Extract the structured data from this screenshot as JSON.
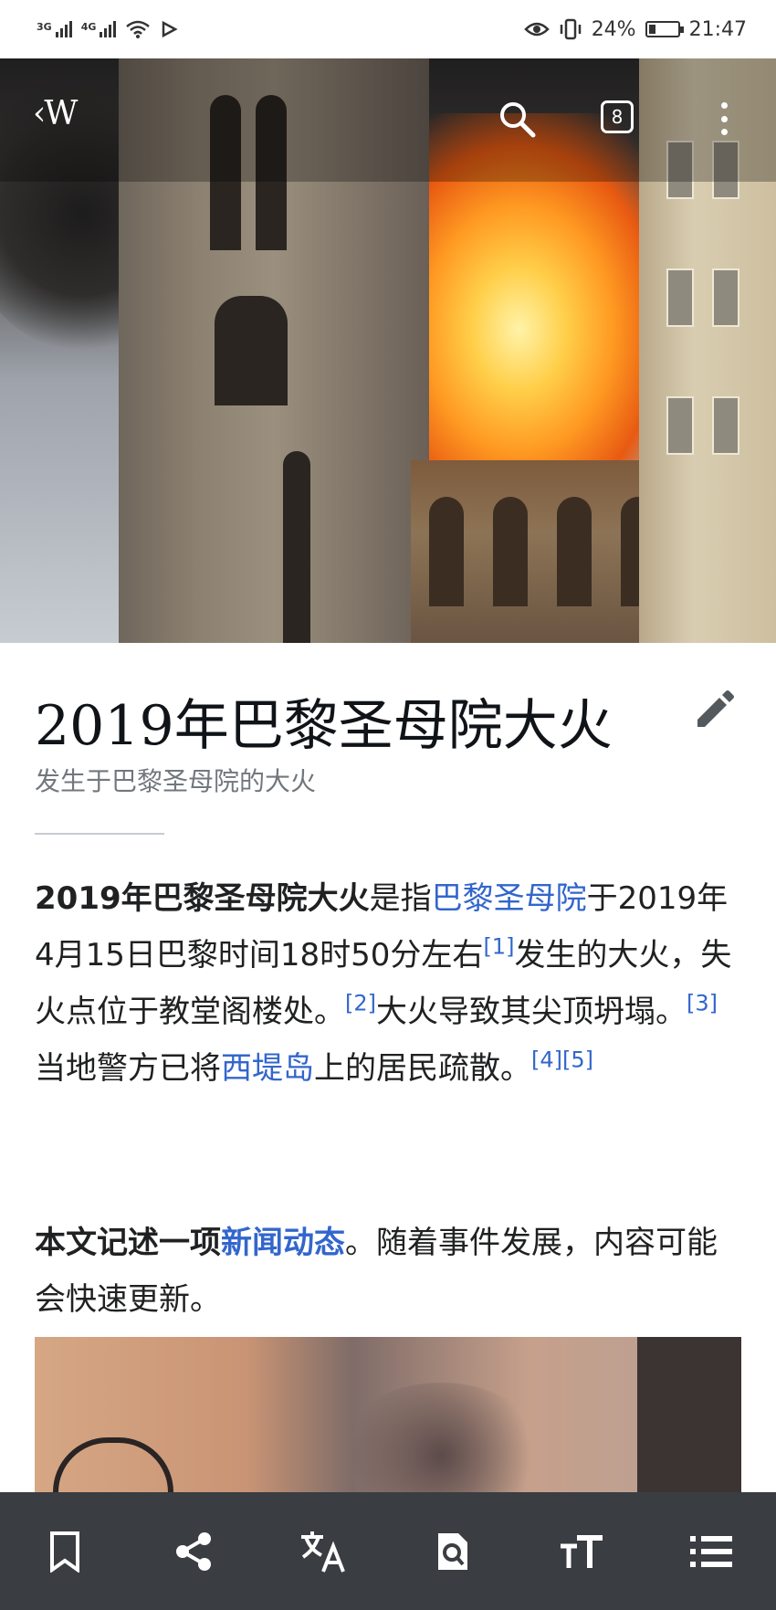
{
  "status_bar": {
    "network_1": "3G",
    "network_2": "4G",
    "battery_percent": "24%",
    "battery_level": 0.24,
    "time": "21:47"
  },
  "header": {
    "logo": "‹W",
    "tabs_count": "8",
    "icons": [
      "back-icon",
      "search-icon",
      "tabs-icon",
      "more-vert-icon"
    ]
  },
  "article": {
    "title": "2019年巴黎圣母院大火",
    "description": "发生于巴黎圣母院的大火",
    "p1": {
      "bold": "2019年巴黎圣母院大火",
      "t1": "是指",
      "link1": "巴黎圣母院",
      "t2": "于2019年4月15日巴黎时间18时50分左右",
      "ref1": "[1]",
      "t3": "发生的大火，失火点位于教堂阁楼处。",
      "ref2": "[2]",
      "t4": "大火导致其尖顶坍塌。",
      "ref3": "[3]",
      "t5": " 当地警方已将",
      "link2": "西堤岛",
      "t6": "上的居民疏散。",
      "ref4": "[4]",
      "ref5": "[5]"
    },
    "p2": {
      "bold": "本文记述一项",
      "link": "新闻动态",
      "text": "。随着事件发展，内容可能会快速更新。"
    }
  },
  "toolbar": {
    "items": [
      "bookmark-icon",
      "share-icon",
      "translate-icon",
      "find-in-page-icon",
      "text-size-icon",
      "contents-icon"
    ]
  },
  "colors": {
    "link": "#3366cc",
    "toolbar_bg": "#3a3d42",
    "subtitle": "#72777d"
  }
}
